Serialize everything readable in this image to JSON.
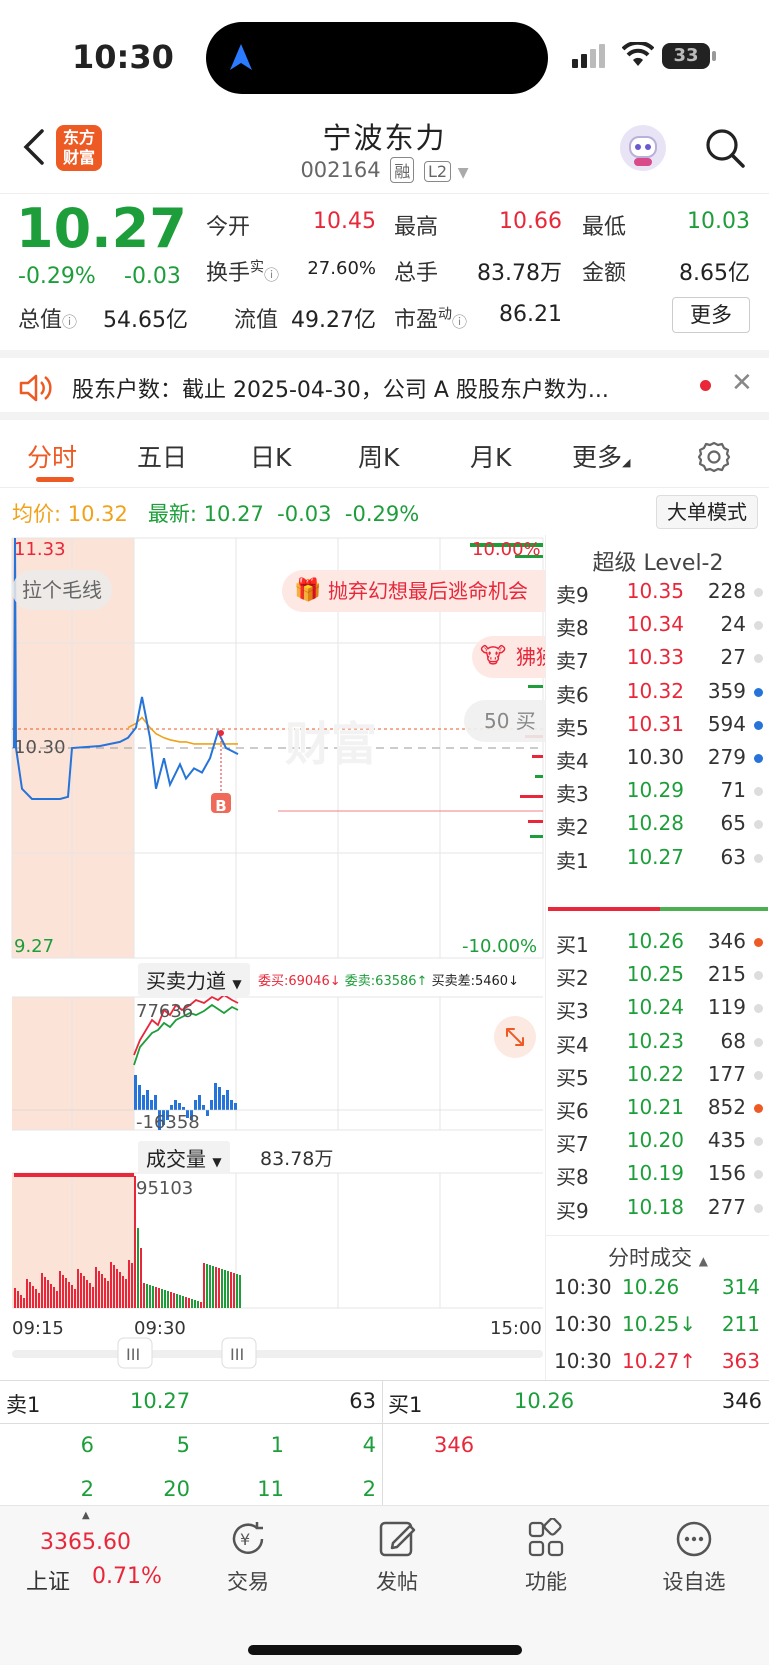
{
  "status_bar": {
    "time": "10:30",
    "battery": "33"
  },
  "header": {
    "logo_line1": "东方",
    "logo_line2": "财富",
    "stock_name": "宁波东力",
    "stock_code": "002164",
    "tag1": "融",
    "tag2": "L2"
  },
  "quote": {
    "price": "10.27",
    "pct": "-0.29%",
    "change": "-0.03",
    "open_label": "今开",
    "open": "10.45",
    "high_label": "最高",
    "high": "10.66",
    "low_label": "最低",
    "low": "10.03",
    "turnover_label": "换手",
    "turnover_sup": "实",
    "turnover": "27.60%",
    "volume_label": "总手",
    "volume": "83.78万",
    "amount_label": "金额",
    "amount": "8.65亿",
    "mcap_label": "总值",
    "mcap": "54.65亿",
    "float_label": "流值",
    "float": "49.27亿",
    "pe_label": "市盈",
    "pe_sup": "动",
    "pe": "86.21",
    "more": "更多"
  },
  "notice": {
    "text": "股东户数：截止 2025-04-30，公司 A 股股东户数为..."
  },
  "tabs": [
    "分时",
    "五日",
    "日K",
    "周K",
    "月K",
    "更多"
  ],
  "info": {
    "avg_label": "均价:",
    "avg": "10.32",
    "latest_label": "最新:",
    "latest": "10.27",
    "change": "-0.03",
    "pct": "-0.29%",
    "mode_button": "大单模式"
  },
  "chart_labels": {
    "top_price": "11.33",
    "bottom_price": "9.27",
    "mid_price": "10.30",
    "top_pct": "10.00%",
    "bottom_pct": "-10.00%",
    "hint": "拉个毛线",
    "banner": "抛弃幻想最后逃命机会",
    "banner2": "狒狒",
    "tag_50": "50 买",
    "b_marker": "B",
    "force_title": "买卖力道",
    "force_buy": "委买:69046",
    "force_sell": "委卖:63586",
    "force_diff": "买卖差:5460",
    "force_top": "77636",
    "force_bottom": "-16358",
    "vol_title": "成交量",
    "vol_total": "83.78万",
    "vol_max": "95103",
    "time_start": "09:15",
    "time_mid": "09:30",
    "time_end": "15:00"
  },
  "chart_data": {
    "type": "line",
    "title": "",
    "ylim": [
      9.27,
      11.33
    ],
    "prev_close": 10.3,
    "series": [
      {
        "name": "price",
        "values": [
          10.3,
          11.33,
          10.3,
          10.1,
          10.05,
          10.05,
          10.06,
          10.3,
          10.31,
          10.33,
          10.35,
          10.4,
          10.55,
          10.35,
          10.1,
          10.25,
          10.12,
          10.22,
          10.15,
          10.2,
          10.18,
          10.25,
          10.38,
          10.3,
          10.27
        ]
      },
      {
        "name": "average",
        "values": [
          null,
          null,
          null,
          null,
          null,
          null,
          null,
          null,
          null,
          null,
          10.4,
          10.42,
          10.45,
          10.4,
          10.37,
          10.35,
          10.34,
          10.33,
          10.33,
          10.32,
          10.32,
          10.32,
          10.32,
          10.32,
          10.32
        ]
      }
    ]
  },
  "level2": {
    "title": "超级 Level-2",
    "asks": [
      {
        "label": "卖9",
        "price": "10.35",
        "vol": "228",
        "color": "#e8283a",
        "dot": "#dddddd"
      },
      {
        "label": "卖8",
        "price": "10.34",
        "vol": "24",
        "color": "#e8283a",
        "dot": "#dddddd"
      },
      {
        "label": "卖7",
        "price": "10.33",
        "vol": "27",
        "color": "#e8283a",
        "dot": "#dddddd"
      },
      {
        "label": "卖6",
        "price": "10.32",
        "vol": "359",
        "color": "#e8283a",
        "dot": "#2673d9"
      },
      {
        "label": "卖5",
        "price": "10.31",
        "vol": "594",
        "color": "#e8283a",
        "dot": "#2673d9"
      },
      {
        "label": "卖4",
        "price": "10.30",
        "vol": "279",
        "color": "#333333",
        "dot": "#2673d9"
      },
      {
        "label": "卖3",
        "price": "10.29",
        "vol": "71",
        "color": "#1d9e3a",
        "dot": "#dddddd"
      },
      {
        "label": "卖2",
        "price": "10.28",
        "vol": "65",
        "color": "#1d9e3a",
        "dot": "#dddddd"
      },
      {
        "label": "卖1",
        "price": "10.27",
        "vol": "63",
        "color": "#1d9e3a",
        "dot": "#dddddd"
      }
    ],
    "bids": [
      {
        "label": "买1",
        "price": "10.26",
        "vol": "346",
        "color": "#1d9e3a",
        "dot": "#ee5a24"
      },
      {
        "label": "买2",
        "price": "10.25",
        "vol": "215",
        "color": "#1d9e3a",
        "dot": "#dddddd"
      },
      {
        "label": "买3",
        "price": "10.24",
        "vol": "119",
        "color": "#1d9e3a",
        "dot": "#dddddd"
      },
      {
        "label": "买4",
        "price": "10.23",
        "vol": "68",
        "color": "#1d9e3a",
        "dot": "#dddddd"
      },
      {
        "label": "买5",
        "price": "10.22",
        "vol": "177",
        "color": "#1d9e3a",
        "dot": "#dddddd"
      },
      {
        "label": "买6",
        "price": "10.21",
        "vol": "852",
        "color": "#1d9e3a",
        "dot": "#ee5a24"
      },
      {
        "label": "买7",
        "price": "10.20",
        "vol": "435",
        "color": "#1d9e3a",
        "dot": "#dddddd"
      },
      {
        "label": "买8",
        "price": "10.19",
        "vol": "156",
        "color": "#1d9e3a",
        "dot": "#dddddd"
      },
      {
        "label": "买9",
        "price": "10.18",
        "vol": "277",
        "color": "#1d9e3a",
        "dot": "#dddddd"
      }
    ],
    "trades_title": "分时成交",
    "trades": [
      {
        "time": "10:30",
        "price": "10.26",
        "vol": "314",
        "price_color": "#1d9e3a",
        "vol_color": "#1d9e3a"
      },
      {
        "time": "10:30",
        "price": "10.25↓",
        "vol": "211",
        "price_color": "#1d9e3a",
        "vol_color": "#1d9e3a"
      },
      {
        "time": "10:30",
        "price": "10.27↑",
        "vol": "363",
        "price_color": "#e8283a",
        "vol_color": "#e8283a"
      }
    ]
  },
  "bottom_quote": {
    "ask_label": "卖1",
    "ask_price": "10.27",
    "ask_vol": "63",
    "bid_label": "买1",
    "bid_price": "10.26",
    "bid_vol": "346",
    "ask_queue_row1": [
      "6",
      "5",
      "1",
      "4"
    ],
    "ask_queue_row2": [
      "2",
      "20",
      "11",
      "2"
    ],
    "bid_queue": "346"
  },
  "nav": {
    "index_value": "3365.60",
    "index_name": "上证",
    "index_pct": "0.71%",
    "items": [
      "交易",
      "发帖",
      "功能",
      "设自选"
    ]
  }
}
